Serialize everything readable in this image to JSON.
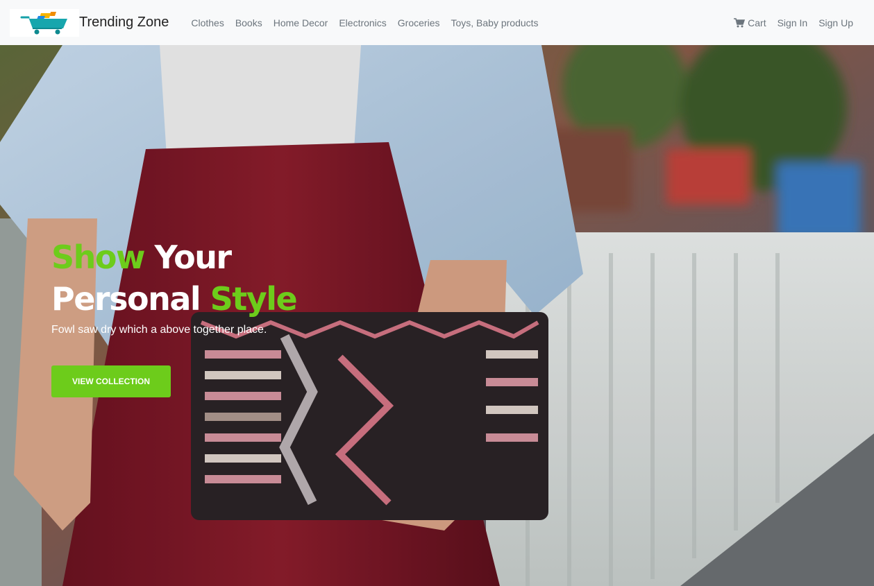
{
  "brand": {
    "name": "Trending Zone",
    "logo_icon": "shopping-cart-logo"
  },
  "nav": {
    "links": [
      {
        "label": "Clothes"
      },
      {
        "label": "Books"
      },
      {
        "label": "Home Decor"
      },
      {
        "label": "Electronics"
      },
      {
        "label": "Groceries"
      },
      {
        "label": "Toys, Baby products"
      }
    ],
    "cart_label": "Cart",
    "cart_icon": "cart-icon",
    "sign_in": "Sign In",
    "sign_up": "Sign Up"
  },
  "hero": {
    "title_word_1": "Show",
    "title_word_2": " Your",
    "title_word_3": "Personal",
    "title_word_4": " Style",
    "subtitle": "Fowl saw dry which a above together place.",
    "button_label": "VIEW COLLECTION",
    "background_image": "woman-holding-embroidered-clutch"
  },
  "colors": {
    "accent": "#6dcc1b",
    "navbar_bg": "#f8f9fa",
    "nav_text": "#6c757d"
  }
}
